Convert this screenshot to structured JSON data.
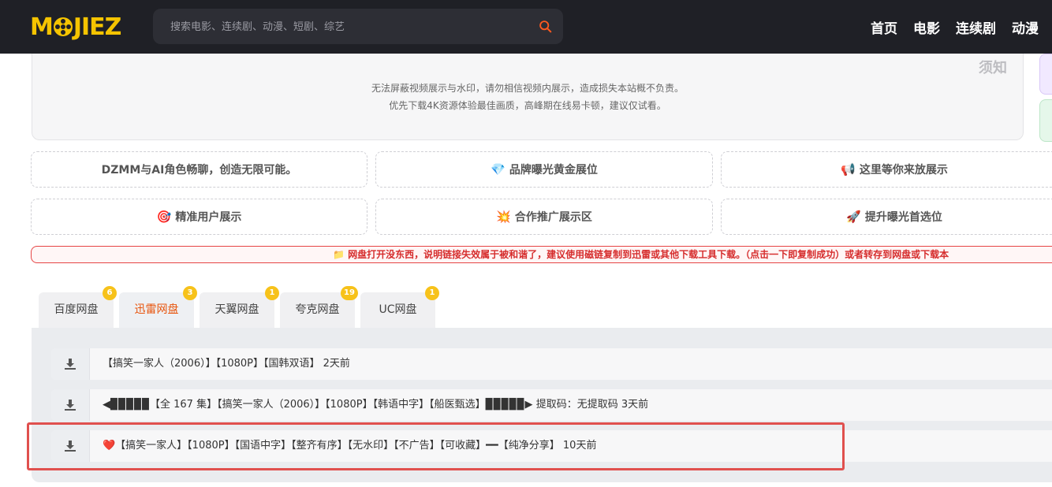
{
  "header": {
    "logo_prefix": "M",
    "logo_suffix": "JIEZ",
    "search_placeholder": "搜索电影、连续剧、动漫、短剧、综艺",
    "nav": [
      "首页",
      "电影",
      "连续剧",
      "动漫"
    ]
  },
  "notice": {
    "label": "须知",
    "line1": "无法屏蔽视频展示与水印，请勿相信视频内展示，造成损失本站概不负责。",
    "line2": "优先下载4K资源体验最佳画质，高峰期在线易卡顿，建议仅试看。"
  },
  "ads": [
    {
      "emoji": "",
      "label": "DZMM与AI角色畅聊，创造无限可能。"
    },
    {
      "emoji": "💎",
      "label": "品牌曝光黄金展位"
    },
    {
      "emoji": "📢",
      "label": "这里等你来放展示"
    },
    {
      "emoji": "🎯",
      "label": "精准用户展示"
    },
    {
      "emoji": "💥",
      "label": "合作推广展示区"
    },
    {
      "emoji": "🚀",
      "label": "提升曝光首选位"
    }
  ],
  "warning": "📁 网盘打开没东西，说明链接失效属于被和谐了，建议使用磁链复制到迅雷或其他下载工具下载。（点击一下即复制成功）或者转存到网盘或下载本",
  "tabs": [
    {
      "label": "百度网盘",
      "count": "6",
      "active": false
    },
    {
      "label": "迅雷网盘",
      "count": "3",
      "active": true
    },
    {
      "label": "天翼网盘",
      "count": "1",
      "active": false
    },
    {
      "label": "夸克网盘",
      "count": "19",
      "active": false
    },
    {
      "label": "UC网盘",
      "count": "1",
      "active": false
    }
  ],
  "rows": [
    "【搞笑一家人（2006）】【1080P】【国韩双语】 2天前",
    "◀▉▉▉▉▉【全 167 集】【搞笑一家人（2006）】【1080P】【韩语中字】【船医甄选】▉▉▉▉▉▶ 提取码：无提取码 3天前",
    "❤️【搞笑一家人】【1080P】【国语中字】【整齐有序】【无水印】【不广告】【可收藏】━━【纯净分享】 10天前"
  ],
  "colors": {
    "header_bg": "#1f2026",
    "logo": "#f5c400",
    "active_tab": "#e8540c",
    "badge": "#f7c21a",
    "warning": "#d62d2d",
    "highlight": "#e0504e"
  }
}
